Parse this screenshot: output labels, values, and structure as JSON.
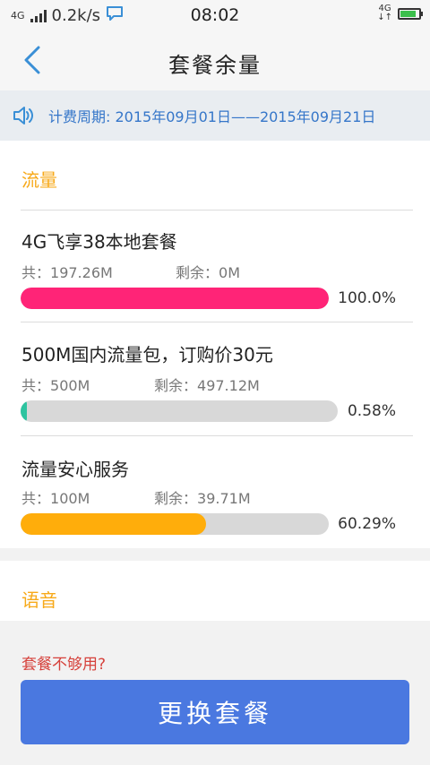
{
  "status": {
    "net_type": "4G",
    "speed": "0.2k/s",
    "time": "08:02",
    "net_small": "4G",
    "battery_level": 0.85
  },
  "nav": {
    "title": "套餐余量"
  },
  "period": {
    "label": "计费周期:",
    "range": "2015年09月01日——2015年09月21日"
  },
  "flow": {
    "title": "流量",
    "total_label": "共：",
    "remain_label": "剩余：",
    "packages": [
      {
        "name": "4G飞享38本地套餐",
        "total": "197.26M",
        "remain": "0M",
        "percent_text": "100.0%",
        "fill": 1.0,
        "color": "#ff2477"
      },
      {
        "name": "500M国内流量包，订购价30元",
        "total": "500M",
        "remain": "497.12M",
        "percent_text": "0.58%",
        "fill": 0.0058,
        "color": "#2ec4a0"
      },
      {
        "name": "流量安心服务",
        "total": "100M",
        "remain": "39.71M",
        "percent_text": "60.29%",
        "fill": 0.6029,
        "color": "#ffad0b"
      }
    ]
  },
  "voice": {
    "title": "语音"
  },
  "footer": {
    "tip": "套餐不够用?",
    "button": "更换套餐"
  },
  "colors": {
    "accent": "#4a78e0",
    "link": "#3576c9",
    "section": "#f7a919",
    "tip": "#d6423c"
  }
}
